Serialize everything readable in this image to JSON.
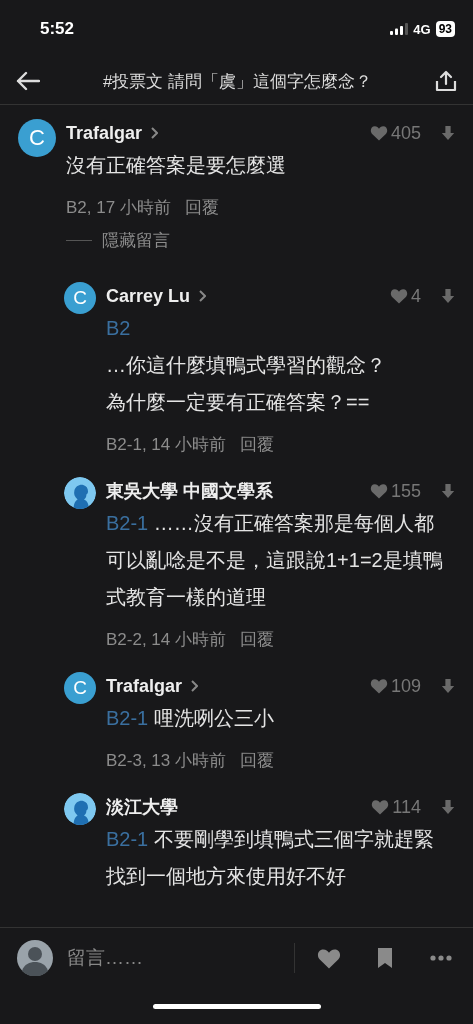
{
  "status_bar": {
    "time": "5:52",
    "network": "4G",
    "battery": "93"
  },
  "nav": {
    "title": "#投票文 請問「虞」這個字怎麼念？"
  },
  "comments": [
    {
      "kind": "top",
      "avatar": {
        "kind": "letter",
        "letter": "C"
      },
      "name": "Trafalgar",
      "profile_link": true,
      "likes": "405",
      "body": [
        "沒有正確答案是要怎麼選"
      ],
      "meta": "B2, 17 小時前",
      "reply": "回覆",
      "hide": "隱藏留言"
    },
    {
      "kind": "reply",
      "avatar": {
        "kind": "letter",
        "letter": "C"
      },
      "name": "Carrey Lu",
      "profile_link": true,
      "likes": "4",
      "mention": "B2",
      "body": [
        "…你這什麼填鴨式學習的觀念？",
        "為什麼一定要有正確答案？=="
      ],
      "meta": "B2-1, 14 小時前",
      "reply": "回覆"
    },
    {
      "kind": "reply",
      "avatar": {
        "kind": "silhouette"
      },
      "name": "東吳大學 中國文學系",
      "profile_link": false,
      "likes": "155",
      "mention": "B2-1",
      "body": [
        "……沒有正確答案那是每個人都可以亂唸是不是，這跟說1+1=2是填鴨式教育一樣的道理"
      ],
      "meta": "B2-2, 14 小時前",
      "reply": "回覆"
    },
    {
      "kind": "reply",
      "avatar": {
        "kind": "letter",
        "letter": "C"
      },
      "name": "Trafalgar",
      "profile_link": true,
      "likes": "109",
      "mention": "B2-1",
      "body": [
        "哩洗咧公三小"
      ],
      "meta": "B2-3, 13 小時前",
      "reply": "回覆"
    },
    {
      "kind": "reply",
      "avatar": {
        "kind": "silhouette"
      },
      "name": "淡江大學",
      "profile_link": false,
      "likes": "114",
      "mention": "B2-1",
      "body": [
        "不要剛學到填鴨式三個字就趕緊找到一個地方來使用好不好"
      ]
    }
  ],
  "composer": {
    "placeholder": "留言……"
  }
}
